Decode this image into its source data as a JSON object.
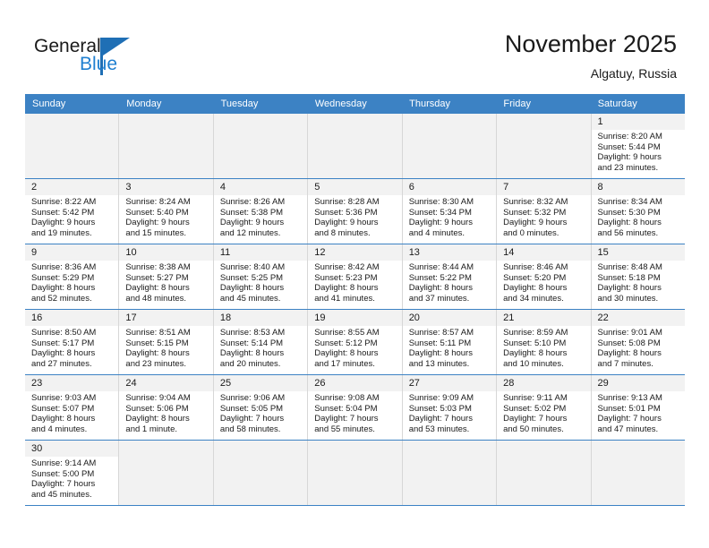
{
  "brand": {
    "name_top": "General",
    "name_bottom": "Blue",
    "flag_icon": "blue-triangle-flag",
    "accent_color": "#1f7fd0"
  },
  "header": {
    "title": "November 2025",
    "subtitle": "Algatuy, Russia"
  },
  "colors": {
    "header_row_bg": "#3c82c4",
    "header_row_text": "#ffffff",
    "daynum_bg": "#f2f2f2",
    "cell_border": "#d7d7d7",
    "week_divider": "#3c82c4"
  },
  "weekdays": [
    "Sunday",
    "Monday",
    "Tuesday",
    "Wednesday",
    "Thursday",
    "Friday",
    "Saturday"
  ],
  "labels": {
    "sunrise": "Sunrise:",
    "sunset": "Sunset:",
    "daylight": "Daylight:"
  },
  "weeks": [
    [
      {
        "empty": true
      },
      {
        "empty": true
      },
      {
        "empty": true
      },
      {
        "empty": true
      },
      {
        "empty": true
      },
      {
        "empty": true
      },
      {
        "day": "1",
        "sunrise": "Sunrise: 8:20 AM",
        "sunset": "Sunset: 5:44 PM",
        "daylight1": "Daylight: 9 hours",
        "daylight2": "and 23 minutes."
      }
    ],
    [
      {
        "day": "2",
        "sunrise": "Sunrise: 8:22 AM",
        "sunset": "Sunset: 5:42 PM",
        "daylight1": "Daylight: 9 hours",
        "daylight2": "and 19 minutes."
      },
      {
        "day": "3",
        "sunrise": "Sunrise: 8:24 AM",
        "sunset": "Sunset: 5:40 PM",
        "daylight1": "Daylight: 9 hours",
        "daylight2": "and 15 minutes."
      },
      {
        "day": "4",
        "sunrise": "Sunrise: 8:26 AM",
        "sunset": "Sunset: 5:38 PM",
        "daylight1": "Daylight: 9 hours",
        "daylight2": "and 12 minutes."
      },
      {
        "day": "5",
        "sunrise": "Sunrise: 8:28 AM",
        "sunset": "Sunset: 5:36 PM",
        "daylight1": "Daylight: 9 hours",
        "daylight2": "and 8 minutes."
      },
      {
        "day": "6",
        "sunrise": "Sunrise: 8:30 AM",
        "sunset": "Sunset: 5:34 PM",
        "daylight1": "Daylight: 9 hours",
        "daylight2": "and 4 minutes."
      },
      {
        "day": "7",
        "sunrise": "Sunrise: 8:32 AM",
        "sunset": "Sunset: 5:32 PM",
        "daylight1": "Daylight: 9 hours",
        "daylight2": "and 0 minutes."
      },
      {
        "day": "8",
        "sunrise": "Sunrise: 8:34 AM",
        "sunset": "Sunset: 5:30 PM",
        "daylight1": "Daylight: 8 hours",
        "daylight2": "and 56 minutes."
      }
    ],
    [
      {
        "day": "9",
        "sunrise": "Sunrise: 8:36 AM",
        "sunset": "Sunset: 5:29 PM",
        "daylight1": "Daylight: 8 hours",
        "daylight2": "and 52 minutes."
      },
      {
        "day": "10",
        "sunrise": "Sunrise: 8:38 AM",
        "sunset": "Sunset: 5:27 PM",
        "daylight1": "Daylight: 8 hours",
        "daylight2": "and 48 minutes."
      },
      {
        "day": "11",
        "sunrise": "Sunrise: 8:40 AM",
        "sunset": "Sunset: 5:25 PM",
        "daylight1": "Daylight: 8 hours",
        "daylight2": "and 45 minutes."
      },
      {
        "day": "12",
        "sunrise": "Sunrise: 8:42 AM",
        "sunset": "Sunset: 5:23 PM",
        "daylight1": "Daylight: 8 hours",
        "daylight2": "and 41 minutes."
      },
      {
        "day": "13",
        "sunrise": "Sunrise: 8:44 AM",
        "sunset": "Sunset: 5:22 PM",
        "daylight1": "Daylight: 8 hours",
        "daylight2": "and 37 minutes."
      },
      {
        "day": "14",
        "sunrise": "Sunrise: 8:46 AM",
        "sunset": "Sunset: 5:20 PM",
        "daylight1": "Daylight: 8 hours",
        "daylight2": "and 34 minutes."
      },
      {
        "day": "15",
        "sunrise": "Sunrise: 8:48 AM",
        "sunset": "Sunset: 5:18 PM",
        "daylight1": "Daylight: 8 hours",
        "daylight2": "and 30 minutes."
      }
    ],
    [
      {
        "day": "16",
        "sunrise": "Sunrise: 8:50 AM",
        "sunset": "Sunset: 5:17 PM",
        "daylight1": "Daylight: 8 hours",
        "daylight2": "and 27 minutes."
      },
      {
        "day": "17",
        "sunrise": "Sunrise: 8:51 AM",
        "sunset": "Sunset: 5:15 PM",
        "daylight1": "Daylight: 8 hours",
        "daylight2": "and 23 minutes."
      },
      {
        "day": "18",
        "sunrise": "Sunrise: 8:53 AM",
        "sunset": "Sunset: 5:14 PM",
        "daylight1": "Daylight: 8 hours",
        "daylight2": "and 20 minutes."
      },
      {
        "day": "19",
        "sunrise": "Sunrise: 8:55 AM",
        "sunset": "Sunset: 5:12 PM",
        "daylight1": "Daylight: 8 hours",
        "daylight2": "and 17 minutes."
      },
      {
        "day": "20",
        "sunrise": "Sunrise: 8:57 AM",
        "sunset": "Sunset: 5:11 PM",
        "daylight1": "Daylight: 8 hours",
        "daylight2": "and 13 minutes."
      },
      {
        "day": "21",
        "sunrise": "Sunrise: 8:59 AM",
        "sunset": "Sunset: 5:10 PM",
        "daylight1": "Daylight: 8 hours",
        "daylight2": "and 10 minutes."
      },
      {
        "day": "22",
        "sunrise": "Sunrise: 9:01 AM",
        "sunset": "Sunset: 5:08 PM",
        "daylight1": "Daylight: 8 hours",
        "daylight2": "and 7 minutes."
      }
    ],
    [
      {
        "day": "23",
        "sunrise": "Sunrise: 9:03 AM",
        "sunset": "Sunset: 5:07 PM",
        "daylight1": "Daylight: 8 hours",
        "daylight2": "and 4 minutes."
      },
      {
        "day": "24",
        "sunrise": "Sunrise: 9:04 AM",
        "sunset": "Sunset: 5:06 PM",
        "daylight1": "Daylight: 8 hours",
        "daylight2": "and 1 minute."
      },
      {
        "day": "25",
        "sunrise": "Sunrise: 9:06 AM",
        "sunset": "Sunset: 5:05 PM",
        "daylight1": "Daylight: 7 hours",
        "daylight2": "and 58 minutes."
      },
      {
        "day": "26",
        "sunrise": "Sunrise: 9:08 AM",
        "sunset": "Sunset: 5:04 PM",
        "daylight1": "Daylight: 7 hours",
        "daylight2": "and 55 minutes."
      },
      {
        "day": "27",
        "sunrise": "Sunrise: 9:09 AM",
        "sunset": "Sunset: 5:03 PM",
        "daylight1": "Daylight: 7 hours",
        "daylight2": "and 53 minutes."
      },
      {
        "day": "28",
        "sunrise": "Sunrise: 9:11 AM",
        "sunset": "Sunset: 5:02 PM",
        "daylight1": "Daylight: 7 hours",
        "daylight2": "and 50 minutes."
      },
      {
        "day": "29",
        "sunrise": "Sunrise: 9:13 AM",
        "sunset": "Sunset: 5:01 PM",
        "daylight1": "Daylight: 7 hours",
        "daylight2": "and 47 minutes."
      }
    ],
    [
      {
        "day": "30",
        "sunrise": "Sunrise: 9:14 AM",
        "sunset": "Sunset: 5:00 PM",
        "daylight1": "Daylight: 7 hours",
        "daylight2": "and 45 minutes."
      },
      {
        "empty": true
      },
      {
        "empty": true
      },
      {
        "empty": true
      },
      {
        "empty": true
      },
      {
        "empty": true
      },
      {
        "empty": true
      }
    ]
  ]
}
